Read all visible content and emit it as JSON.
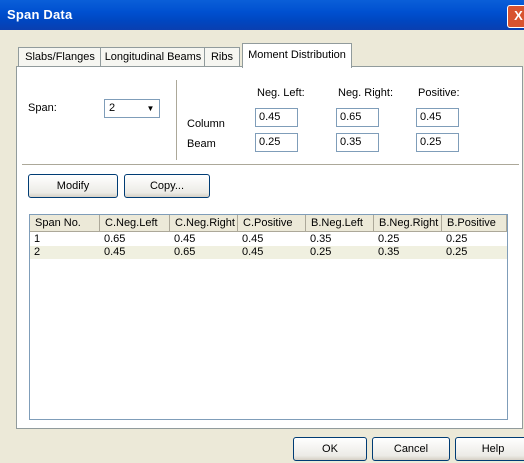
{
  "window": {
    "title": "Span Data",
    "close_label": "X"
  },
  "tabs": [
    {
      "label": "Slabs/Flanges",
      "active": false
    },
    {
      "label": "Longitudinal Beams",
      "active": false
    },
    {
      "label": "Ribs",
      "active": false
    },
    {
      "label": "Moment Distribution",
      "active": true
    }
  ],
  "form": {
    "span_label": "Span:",
    "span_value": "2",
    "col_headers": [
      "Neg. Left:",
      "Neg. Right:",
      "Positive:"
    ],
    "rows": [
      {
        "label": "Column",
        "values": [
          "0.45",
          "0.65",
          "0.45"
        ]
      },
      {
        "label": "Beam",
        "values": [
          "0.25",
          "0.35",
          "0.25"
        ]
      }
    ]
  },
  "actions": {
    "modify": "Modify",
    "copy": "Copy..."
  },
  "table": {
    "headers": [
      "Span No.",
      "C.Neg.Left",
      "C.Neg.Right",
      "C.Positive",
      "B.Neg.Left",
      "B.Neg.Right",
      "B.Positive"
    ],
    "rows": [
      [
        "1",
        "0.65",
        "0.45",
        "0.45",
        "0.35",
        "0.25",
        "0.25"
      ],
      [
        "2",
        "0.45",
        "0.65",
        "0.45",
        "0.25",
        "0.35",
        "0.25"
      ]
    ]
  },
  "footer": {
    "ok": "OK",
    "cancel": "Cancel",
    "help": "Help"
  }
}
